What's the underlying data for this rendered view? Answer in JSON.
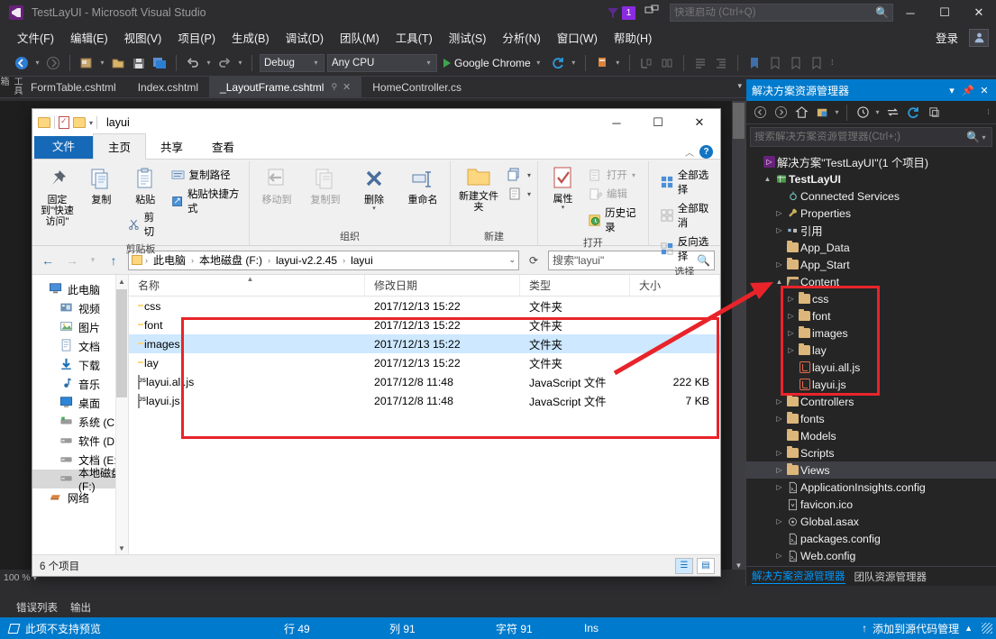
{
  "vs": {
    "title": "TestLayUI - Microsoft Visual Studio",
    "logo_name": "visual-studio-logo",
    "notification_count": "1",
    "quick_launch_placeholder": "快速启动 (Ctrl+Q)",
    "signin": "登录",
    "minimize": "─",
    "maximize": "☐",
    "close": "✕",
    "menu": [
      {
        "label": "文件(F)"
      },
      {
        "label": "编辑(E)"
      },
      {
        "label": "视图(V)"
      },
      {
        "label": "项目(P)"
      },
      {
        "label": "生成(B)"
      },
      {
        "label": "调试(D)"
      },
      {
        "label": "团队(M)"
      },
      {
        "label": "工具(T)"
      },
      {
        "label": "测试(S)"
      },
      {
        "label": "分析(N)"
      },
      {
        "label": "窗口(W)"
      },
      {
        "label": "帮助(H)"
      }
    ],
    "toolbar": {
      "config": "Debug",
      "platform": "Any CPU",
      "run_target": "Google Chrome",
      "back_icon": "navigate-back-icon",
      "forward_icon": "navigate-forward-icon",
      "new_project_icon": "new-project-icon",
      "open_icon": "open-file-icon",
      "save_icon": "save-icon",
      "save_all_icon": "save-all-icon",
      "undo_icon": "undo-icon",
      "redo_icon": "redo-icon",
      "refresh_icon": "refresh-icon"
    },
    "side_tab": "工具箱",
    "doc_tabs": [
      {
        "label": "FormTable.cshtml",
        "active": false
      },
      {
        "label": "Index.cshtml",
        "active": false
      },
      {
        "label": "_LayoutFrame.cshtml",
        "active": true
      },
      {
        "label": "HomeController.cs",
        "active": false
      }
    ],
    "editor_zoom": "100 %",
    "bottom_tabs": [
      {
        "label": "错误列表"
      },
      {
        "label": "输出"
      }
    ],
    "status": {
      "message": "此项不支持预览",
      "line": "行 49",
      "column": "列 91",
      "chars": "字符 91",
      "insert_mode": "Ins",
      "source_control": "添加到源代码管理"
    }
  },
  "solution_explorer": {
    "title": "解决方案资源管理器",
    "dropdown_icon": "chevron-down-icon",
    "pin_icon": "pin-icon",
    "close_icon": "close-icon",
    "search_placeholder": "搜索解决方案资源管理器(Ctrl+;)",
    "search_icon": "search-icon",
    "toolbar_icons": [
      "back-icon",
      "forward-icon",
      "home-icon",
      "pending-changes-icon",
      "show-all-files-icon",
      "refresh-icon",
      "collapse-all-icon",
      "properties-icon"
    ],
    "tree": [
      {
        "indent": 0,
        "twist": "",
        "icon": "solution-icon",
        "label": "解决方案\"TestLayUI\"(1 个项目)",
        "bold": false,
        "selected": false
      },
      {
        "indent": 1,
        "twist": "▲",
        "icon": "project-icon",
        "label": "TestLayUI",
        "bold": true,
        "selected": false
      },
      {
        "indent": 2,
        "twist": "",
        "icon": "connected-services-icon",
        "label": "Connected Services",
        "bold": false,
        "selected": false
      },
      {
        "indent": 2,
        "twist": "▷",
        "icon": "properties-icon",
        "label": "Properties",
        "bold": false,
        "selected": false
      },
      {
        "indent": 2,
        "twist": "▷",
        "icon": "references-icon",
        "label": "引用",
        "bold": false,
        "selected": false
      },
      {
        "indent": 2,
        "twist": "",
        "icon": "folder-icon",
        "label": "App_Data",
        "bold": false,
        "selected": false
      },
      {
        "indent": 2,
        "twist": "▷",
        "icon": "folder-icon",
        "label": "App_Start",
        "bold": false,
        "selected": false
      },
      {
        "indent": 2,
        "twist": "▲",
        "icon": "folder-open-icon",
        "label": "Content",
        "bold": false,
        "selected": false
      },
      {
        "indent": 3,
        "twist": "▷",
        "icon": "folder-icon",
        "label": "css",
        "bold": false,
        "selected": false
      },
      {
        "indent": 3,
        "twist": "▷",
        "icon": "folder-icon",
        "label": "font",
        "bold": false,
        "selected": false
      },
      {
        "indent": 3,
        "twist": "▷",
        "icon": "folder-icon",
        "label": "images",
        "bold": false,
        "selected": false
      },
      {
        "indent": 3,
        "twist": "▷",
        "icon": "folder-icon",
        "label": "lay",
        "bold": false,
        "selected": false
      },
      {
        "indent": 3,
        "twist": "",
        "icon": "js-file-icon",
        "label": "layui.all.js",
        "bold": false,
        "selected": false
      },
      {
        "indent": 3,
        "twist": "",
        "icon": "js-file-icon",
        "label": "layui.js",
        "bold": false,
        "selected": false
      },
      {
        "indent": 2,
        "twist": "▷",
        "icon": "folder-icon",
        "label": "Controllers",
        "bold": false,
        "selected": false
      },
      {
        "indent": 2,
        "twist": "▷",
        "icon": "folder-icon",
        "label": "fonts",
        "bold": false,
        "selected": false
      },
      {
        "indent": 2,
        "twist": "",
        "icon": "folder-icon",
        "label": "Models",
        "bold": false,
        "selected": false
      },
      {
        "indent": 2,
        "twist": "▷",
        "icon": "folder-icon",
        "label": "Scripts",
        "bold": false,
        "selected": false
      },
      {
        "indent": 2,
        "twist": "▷",
        "icon": "folder-icon",
        "label": "Views",
        "bold": false,
        "selected": true
      },
      {
        "indent": 2,
        "twist": "▷",
        "icon": "config-file-icon",
        "label": "ApplicationInsights.config",
        "bold": false,
        "selected": false
      },
      {
        "indent": 2,
        "twist": "",
        "icon": "ico-file-icon",
        "label": "favicon.ico",
        "bold": false,
        "selected": false
      },
      {
        "indent": 2,
        "twist": "▷",
        "icon": "asax-file-icon",
        "label": "Global.asax",
        "bold": false,
        "selected": false
      },
      {
        "indent": 2,
        "twist": "",
        "icon": "config-file-icon",
        "label": "packages.config",
        "bold": false,
        "selected": false
      },
      {
        "indent": 2,
        "twist": "▷",
        "icon": "config-file-icon",
        "label": "Web.config",
        "bold": false,
        "selected": false
      }
    ],
    "panel_tabs": [
      {
        "label": "解决方案资源管理器",
        "active": true
      },
      {
        "label": "团队资源管理器",
        "active": false
      }
    ]
  },
  "explorer": {
    "folder_name": "layui",
    "quick_access_icons": [
      "folder-icon",
      "properties-icon",
      "new-folder-icon",
      "chevron-down-icon"
    ],
    "window_buttons": {
      "minimize": "─",
      "maximize": "☐",
      "close": "✕"
    },
    "ribbon_tabs": [
      {
        "label": "文件",
        "kind": "file"
      },
      {
        "label": "主页",
        "kind": "active"
      },
      {
        "label": "共享",
        "kind": "normal"
      },
      {
        "label": "查看",
        "kind": "normal"
      }
    ],
    "ribbon_collapse_icon": "chevron-up-icon",
    "help_icon": "help-icon",
    "ribbon_groups": [
      {
        "title": "剪贴板",
        "big": [
          {
            "label": "固定到\"快速访问\"",
            "icon": "pin-icon",
            "disabled": false
          },
          {
            "label": "复制",
            "icon": "copy-icon",
            "disabled": false
          },
          {
            "label": "粘贴",
            "icon": "paste-icon",
            "disabled": false
          }
        ],
        "small": [
          {
            "label": "复制路径",
            "icon": "copy-path-icon",
            "disabled": false
          },
          {
            "label": "粘贴快捷方式",
            "icon": "paste-shortcut-icon",
            "disabled": false
          },
          {
            "label": "剪切",
            "icon": "cut-icon",
            "disabled": false
          }
        ]
      },
      {
        "title": "组织",
        "big": [
          {
            "label": "移动到",
            "icon": "move-to-icon",
            "disabled": true
          },
          {
            "label": "复制到",
            "icon": "copy-to-icon",
            "disabled": true
          },
          {
            "label": "删除",
            "icon": "delete-icon",
            "disabled": false
          },
          {
            "label": "重命名",
            "icon": "rename-icon",
            "disabled": false
          }
        ],
        "small": []
      },
      {
        "title": "新建",
        "big": [
          {
            "label": "新建文件夹",
            "icon": "new-folder-icon",
            "disabled": false
          }
        ],
        "small": [
          {
            "label": "",
            "icon": "new-item-icon",
            "disabled": false
          },
          {
            "label": "",
            "icon": "easy-access-icon",
            "disabled": false
          }
        ]
      },
      {
        "title": "打开",
        "big": [
          {
            "label": "属性",
            "icon": "properties-icon",
            "disabled": false
          }
        ],
        "small": [
          {
            "label": "打开",
            "icon": "open-icon",
            "disabled": true
          },
          {
            "label": "编辑",
            "icon": "edit-icon",
            "disabled": true
          },
          {
            "label": "历史记录",
            "icon": "history-icon",
            "disabled": false
          }
        ]
      },
      {
        "title": "选择",
        "big": [],
        "small": [
          {
            "label": "全部选择",
            "icon": "select-all-icon",
            "disabled": false
          },
          {
            "label": "全部取消",
            "icon": "select-none-icon",
            "disabled": false
          },
          {
            "label": "反向选择",
            "icon": "invert-selection-icon",
            "disabled": false
          }
        ]
      }
    ],
    "nav": {
      "back_icon": "back-arrow-icon",
      "forward_icon": "forward-arrow-icon",
      "recent_icon": "recent-locations-icon",
      "up_icon": "up-arrow-icon",
      "refresh_icon": "refresh-icon",
      "dropdown_icon": "chevron-down-icon",
      "breadcrumbs": [
        "此电脑",
        "本地磁盘 (F:)",
        "layui-v2.2.45",
        "layui"
      ],
      "search_placeholder": "搜索\"layui\"",
      "search_icon": "search-icon"
    },
    "sidebar": [
      {
        "label": "此电脑",
        "icon": "computer-icon",
        "indent": 0,
        "selected": false
      },
      {
        "label": "视频",
        "icon": "videos-icon",
        "indent": 1,
        "selected": false
      },
      {
        "label": "图片",
        "icon": "pictures-icon",
        "indent": 1,
        "selected": false
      },
      {
        "label": "文档",
        "icon": "documents-icon",
        "indent": 1,
        "selected": false
      },
      {
        "label": "下载",
        "icon": "downloads-icon",
        "indent": 1,
        "selected": false
      },
      {
        "label": "音乐",
        "icon": "music-icon",
        "indent": 1,
        "selected": false
      },
      {
        "label": "桌面",
        "icon": "desktop-icon",
        "indent": 1,
        "selected": false
      },
      {
        "label": "系统 (C:)",
        "icon": "system-drive-icon",
        "indent": 1,
        "selected": false
      },
      {
        "label": "软件 (D:)",
        "icon": "drive-icon",
        "indent": 1,
        "selected": false
      },
      {
        "label": "文档 (E:)",
        "icon": "drive-icon",
        "indent": 1,
        "selected": false
      },
      {
        "label": "本地磁盘 (F:)",
        "icon": "drive-icon",
        "indent": 1,
        "selected": true
      },
      {
        "label": "网络",
        "icon": "network-icon",
        "indent": 0,
        "selected": false
      }
    ],
    "columns": [
      "名称",
      "修改日期",
      "类型",
      "大小"
    ],
    "files": [
      {
        "name": "css",
        "date": "2017/12/13 15:22",
        "type": "文件夹",
        "size": "",
        "icon": "folder-icon",
        "selected": false
      },
      {
        "name": "font",
        "date": "2017/12/13 15:22",
        "type": "文件夹",
        "size": "",
        "icon": "folder-icon",
        "selected": false
      },
      {
        "name": "images",
        "date": "2017/12/13 15:22",
        "type": "文件夹",
        "size": "",
        "icon": "folder-icon",
        "selected": true
      },
      {
        "name": "lay",
        "date": "2017/12/13 15:22",
        "type": "文件夹",
        "size": "",
        "icon": "folder-icon",
        "selected": false
      },
      {
        "name": "layui.all.js",
        "date": "2017/12/8 11:48",
        "type": "JavaScript 文件",
        "size": "222 KB",
        "icon": "js-file-icon",
        "selected": false
      },
      {
        "name": "layui.js",
        "date": "2017/12/8 11:48",
        "type": "JavaScript 文件",
        "size": "7 KB",
        "icon": "js-file-icon",
        "selected": false
      }
    ],
    "status": {
      "item_count": "6 个项目",
      "detail_view_icon": "details-view-icon",
      "large_icons_view_icon": "large-icons-view-icon"
    }
  },
  "annotations": {
    "highlight_color": "#e8242a",
    "file_list_rect": "red-rectangle-file-list",
    "tree_rect": "red-rectangle-solution-tree",
    "arrow": "red-arrow-pointing-to-content-folder"
  }
}
